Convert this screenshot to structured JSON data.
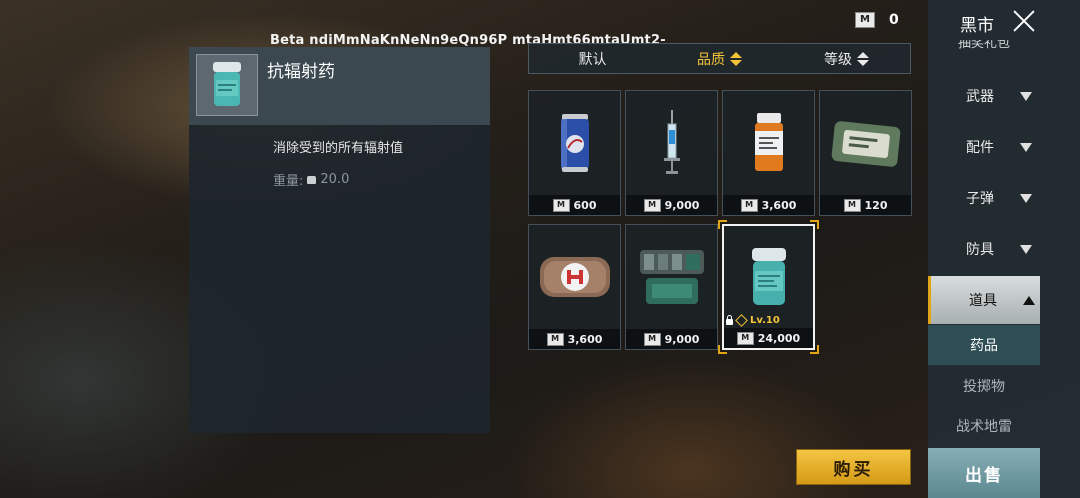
{
  "watermark": "Beta ndiMmNaKnNeNn9eQn96P mtaHmt66mtaUmt2-",
  "currency": {
    "icon": "M",
    "amount": "0"
  },
  "detail": {
    "title": "抗辐射药",
    "description": "消除受到的所有辐射值",
    "weight_label": "重量:",
    "weight_value": "20.0"
  },
  "sort": [
    {
      "label": "默认",
      "active": false,
      "arrows": false
    },
    {
      "label": "品质",
      "active": true,
      "arrows": true
    },
    {
      "label": "等级",
      "active": false,
      "arrows": true
    }
  ],
  "items": [
    {
      "price": "600",
      "icon": "energy-drink-can-icon"
    },
    {
      "price": "9,000",
      "icon": "syringe-icon"
    },
    {
      "price": "3,600",
      "icon": "pill-bottle-icon"
    },
    {
      "price": "120",
      "icon": "bandage-icon"
    },
    {
      "price": "3,600",
      "icon": "first-aid-pouch-icon"
    },
    {
      "price": "9,000",
      "icon": "medkit-icon"
    },
    {
      "price": "24,000",
      "icon": "anti-radiation-jar-icon",
      "level": "Lv.10",
      "selected": true
    }
  ],
  "buy_label": "购买",
  "sidebar": {
    "title": "黑市",
    "cut_label": "抽奖礼包",
    "categories": [
      "武器",
      "配件",
      "子弹",
      "防具",
      "道具"
    ],
    "subcategories": [
      "药品",
      "投掷物",
      "战术地雷"
    ],
    "sell_label": "出售"
  },
  "colors": {
    "accent": "#f3c437",
    "panel": "#1e262c",
    "sidebar": "#222d34"
  }
}
